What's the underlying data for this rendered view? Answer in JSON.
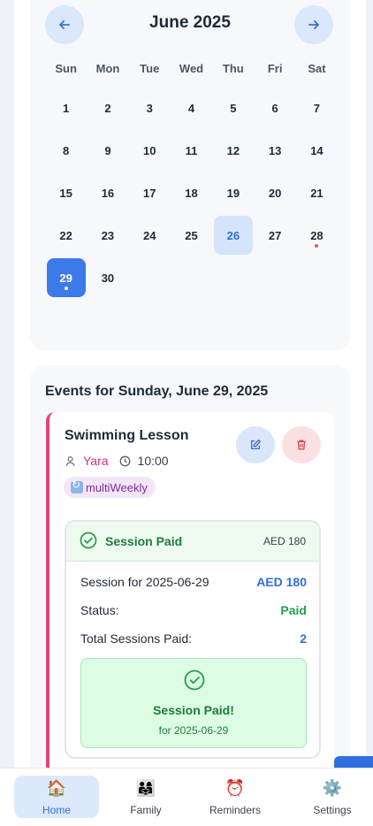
{
  "calendar": {
    "month_title": "June 2025",
    "weekdays": [
      "Sun",
      "Mon",
      "Tue",
      "Wed",
      "Thu",
      "Fri",
      "Sat"
    ],
    "start_offset": 0,
    "days": [
      {
        "n": "1"
      },
      {
        "n": "2"
      },
      {
        "n": "3"
      },
      {
        "n": "4"
      },
      {
        "n": "5"
      },
      {
        "n": "6"
      },
      {
        "n": "7"
      },
      {
        "n": "8"
      },
      {
        "n": "9"
      },
      {
        "n": "10"
      },
      {
        "n": "11"
      },
      {
        "n": "12"
      },
      {
        "n": "13"
      },
      {
        "n": "14"
      },
      {
        "n": "15"
      },
      {
        "n": "16"
      },
      {
        "n": "17"
      },
      {
        "n": "18"
      },
      {
        "n": "19"
      },
      {
        "n": "20"
      },
      {
        "n": "21"
      },
      {
        "n": "22"
      },
      {
        "n": "23"
      },
      {
        "n": "24"
      },
      {
        "n": "25"
      },
      {
        "n": "26",
        "state": "today"
      },
      {
        "n": "27"
      },
      {
        "n": "28",
        "dot": true
      },
      {
        "n": "29",
        "state": "selected",
        "dot": true
      },
      {
        "n": "30"
      }
    ]
  },
  "events": {
    "heading": "Events for Sunday, June 29, 2025",
    "item": {
      "title": "Swimming Lesson",
      "member": "Yara",
      "time": "10:00",
      "recurrence_tag": "multiWeekly",
      "accent_color": "#e0457a",
      "payment": {
        "header_label": "Session Paid",
        "header_amount": "AED 180",
        "session_label": "Session for 2025-06-29",
        "session_amount": "AED 180",
        "status_label": "Status:",
        "status_value": "Paid",
        "total_label": "Total Sessions Paid:",
        "total_value": "2",
        "success_title": "Session Paid!",
        "success_sub": "for 2025-06-29"
      }
    }
  },
  "bottom_nav": [
    {
      "label": "Home",
      "emoji": "🏠",
      "active": true
    },
    {
      "label": "Family",
      "emoji": "👨‍👩‍👧",
      "active": false
    },
    {
      "label": "Reminders",
      "emoji": "⏰",
      "active": false
    },
    {
      "label": "Settings",
      "emoji": "⚙️",
      "active": false
    }
  ],
  "colors": {
    "primary": "#3b7ae8",
    "success": "#22a04b",
    "danger": "#d9475a"
  },
  "icons": {
    "prev": "arrow-left-icon",
    "next": "arrow-right-icon",
    "edit": "edit-icon",
    "delete": "trash-icon",
    "member": "user-icon",
    "time": "clock-icon",
    "paid": "check-circle-icon"
  }
}
